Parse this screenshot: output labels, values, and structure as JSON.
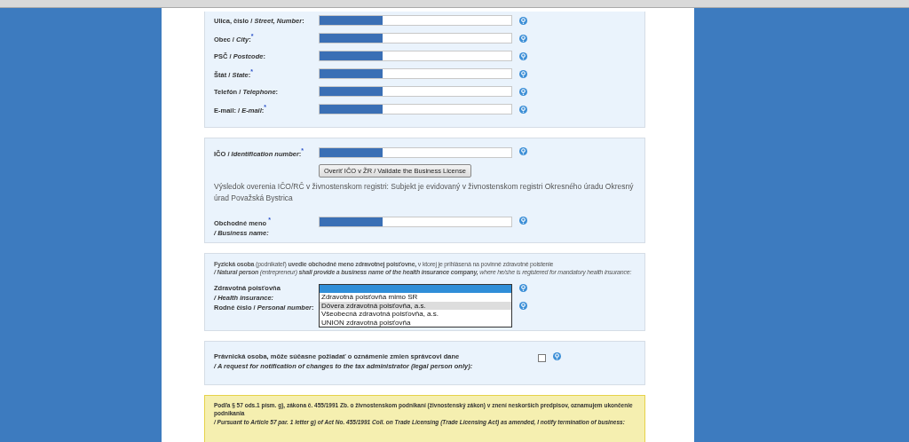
{
  "address_fields": [
    {
      "label": "Ulica, číslo / *Street, Number*:",
      "redacted": true
    },
    {
      "label": "Obec / *City*:$^{*}$",
      "redacted": true
    },
    {
      "label": "PSČ / *Postcode*:",
      "redacted": true
    },
    {
      "label": "Štát / *State*:$^{*}$",
      "redacted": true
    },
    {
      "label": "Telefón / *Telephone*:",
      "redacted": true
    },
    {
      "label": "E-mail: / *E-mail*:$^{*}$",
      "redacted": true
    }
  ],
  "identification": {
    "ico_label": "IČO / *Identification number*:$^{*}$",
    "ico_redacted": true,
    "validate_button": "Overiť IČO v ŽR / Validate the Business License",
    "result": "Výsledok overenia IČO/RČ v živnostenskom registri: Subjekt je evidovaný v živnostenskom registri Okresného úradu Okresný úrad Považská Bystrica",
    "name_label": "Obchodné meno $^{*}$",
    "name_label_en": "/ Business name:",
    "name_redacted": true
  },
  "health": {
    "note": "**Fyzická osoba** (podnikateľ) **uvedie obchodné meno zdravotnej poisťovne,** v ktorej je prihlásená na povinné zdravotné poistenie",
    "note_en": "**/ Natural person** (entrepreneur) **shall provide a business name of the health insurance company,** where he/she is registered for mandatory health insurance:",
    "insurance_label": "Zdravotná poisťovňa",
    "insurance_label_en": "/ Health insurance:",
    "personal_label": "Rodné číslo / *Personal number*:",
    "options": [
      {
        "selected": true,
        "hovered": false
      },
      {
        "label": "Zdravotná poisťovňa mimo SR",
        "selected": false,
        "hovered": false
      },
      {
        "label": "Dôvera zdravotná poisťovňa, a.s.",
        "selected": false,
        "hovered": true
      },
      {
        "label": "Všeobecná zdravotná poisťovňa, a.s.",
        "selected": false,
        "hovered": false
      },
      {
        "label": "UNION zdravotná poisťovňa",
        "selected": false,
        "hovered": false
      }
    ]
  },
  "tax_request": {
    "label": "Právnická osoba, môže súčasne požiadať o oznámenie zmien správcovi dane",
    "label_en": "/ A request for notification of changes to the tax administrator (legal person only):",
    "checked": false
  },
  "termination": {
    "text": "Podľa § 57 ods.1 písm. g), zákona č. 455/1991 Zb. o živnostenskom podnikaní (živnostenský zákon) v znení neskorších predpisov, oznamujem ukončenie podnikania",
    "text_en": "/ Pursuant to Article 57 par. 1 letter g) of Act No. 455/1991 Coll. on Trade Licensing (Trade Licensing Act) as amended, I notify termination of business:"
  }
}
